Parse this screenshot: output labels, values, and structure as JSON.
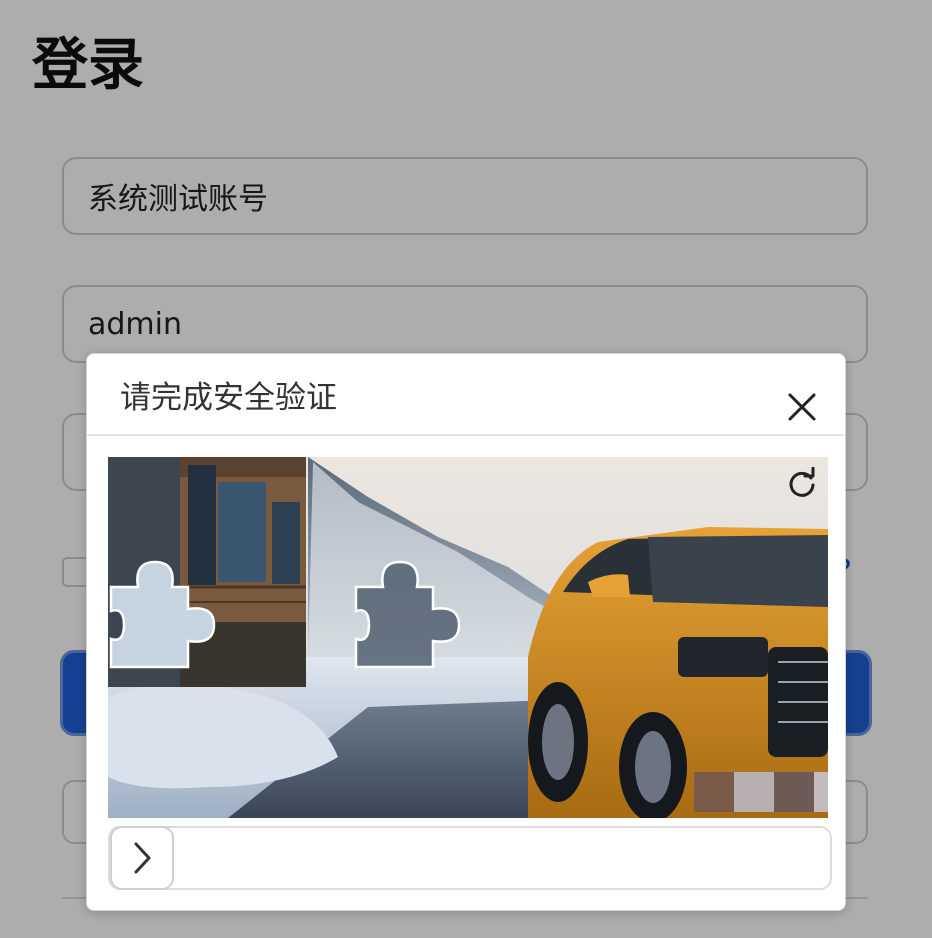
{
  "page": {
    "title": "登录",
    "account_value": "系统测试账号",
    "username_value": "admin",
    "forgot_link_fragment": "?"
  },
  "captcha": {
    "title": "请完成安全验证",
    "close_icon": "close-icon",
    "refresh_icon": "refresh-icon",
    "slider_icon": "chevron-right-icon",
    "slider_value": 0
  },
  "colors": {
    "primary_blue": "#1f5fd6",
    "car_orange": "#c98a22",
    "overlay": "rgba(0,0,0,0.32)"
  }
}
